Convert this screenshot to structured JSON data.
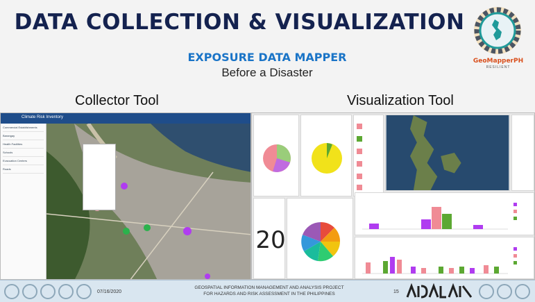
{
  "slide": {
    "title": "DATA COLLECTION & VISUALIZATION",
    "subtitle": "EXPOSURE DATA MAPPER",
    "caption": "Before a Disaster",
    "collector_label": "Collector Tool",
    "visualization_label": "Visualization Tool"
  },
  "logo": {
    "name": "GeoMapperPH",
    "tagline": "RESILIENT",
    "icon": "geomapper-gear-logo"
  },
  "collector": {
    "app_title": "Climate Risk Inventory",
    "layers": [
      "Commercial Establishments",
      "Barangay",
      "Health Facilities",
      "Schools",
      "Evacuation Centers",
      "Roads"
    ]
  },
  "visualization": {
    "big_number": "20"
  },
  "footer": {
    "date": "07/16/2020",
    "project_line1": "GEOSPATIAL INFORMATION MANAGEMENT AND ANALYSIS PROJECT",
    "project_line2": "FOR HAZARDS AND RISK ASSESSMENT IN THE PHILIPPINES",
    "page": "15"
  },
  "colors": {
    "title": "#14224f",
    "subtitle": "#1a74c7",
    "accent": "#d94f1c",
    "header": "#1f4d8a"
  }
}
